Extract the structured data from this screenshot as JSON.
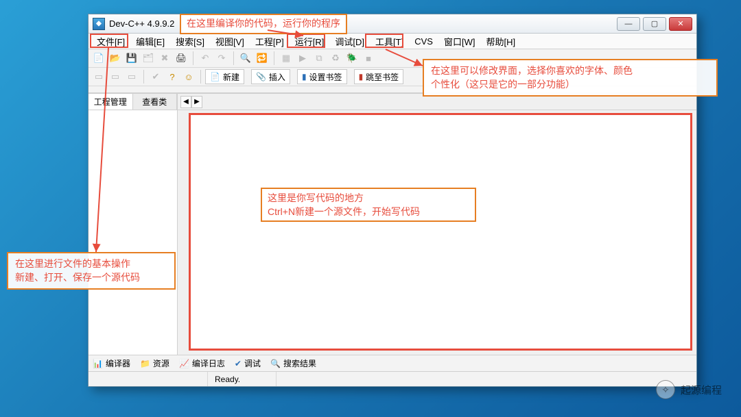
{
  "titlebar": {
    "app_icon_label": "Dev",
    "title": "Dev-C++ 4.9.9.2"
  },
  "windowButtons": {
    "min": "—",
    "max": "▢",
    "close": "✕"
  },
  "menu": {
    "items": [
      {
        "label": "文件[F]"
      },
      {
        "label": "编辑[E]"
      },
      {
        "label": "搜索[S]"
      },
      {
        "label": "视图[V]"
      },
      {
        "label": "工程[P]"
      },
      {
        "label": "运行[R]"
      },
      {
        "label": "调试[D]"
      },
      {
        "label": "工具[T]"
      },
      {
        "label": "CVS"
      },
      {
        "label": "窗口[W]"
      },
      {
        "label": "帮助[H]"
      }
    ]
  },
  "toolbar1": {
    "icons": [
      "new-file",
      "open-file",
      "save",
      "save-all",
      "close",
      "print",
      "sep",
      "undo",
      "redo",
      "sep",
      "find",
      "replace",
      "sep",
      "compile",
      "run",
      "compile-run",
      "rebuild",
      "debug",
      "stop"
    ]
  },
  "toolbar2": {
    "new_label": "新建",
    "insert_label": "插入",
    "set_bookmark_label": "设置书签",
    "goto_bookmark_label": "跳至书签"
  },
  "sidepanel": {
    "tabs": [
      {
        "label": "工程管理"
      },
      {
        "label": "查看类"
      }
    ]
  },
  "tabstrip": {
    "left": "◀",
    "right": "▶"
  },
  "bottom_tabs": [
    {
      "icon": "📊",
      "label": "编译器"
    },
    {
      "icon": "📁",
      "label": "资源"
    },
    {
      "icon": "📈",
      "label": "编译日志"
    },
    {
      "icon": "✔",
      "label": "调试"
    },
    {
      "icon": "🔍",
      "label": "搜索结果"
    }
  ],
  "statusbar": {
    "ready": "Ready."
  },
  "annotations": {
    "top": "在这里编译你的代码，运行你的程序",
    "right_line1": "在这里可以修改界面，选择你喜欢的字体、颜色",
    "right_line2": "个性化（这只是它的一部分功能）",
    "center_line1": "这里是你写代码的地方",
    "center_line2": "Ctrl+N新建一个源文件，开始写代码",
    "left_line1": "在这里进行文件的基本操作",
    "left_line2": "新建、打开、保存一个源代码"
  },
  "watermark": {
    "text": "起源编程"
  }
}
